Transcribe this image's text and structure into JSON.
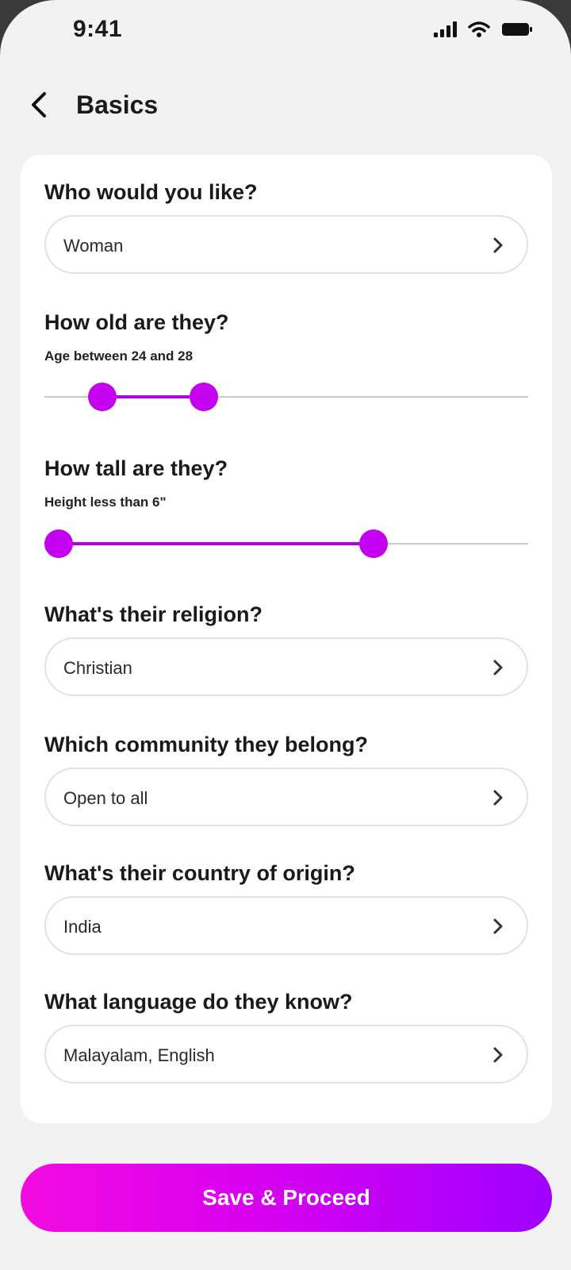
{
  "status_bar": {
    "time": "9:41",
    "icons": [
      "signal-icon",
      "wifi-icon",
      "battery-icon"
    ]
  },
  "header": {
    "title": "Basics",
    "back_icon": "chevron-left-icon"
  },
  "form": {
    "gender": {
      "question": "Who would you like?",
      "value": "Woman"
    },
    "age": {
      "question": "How old are they?",
      "caption": "Age between 24 and 28",
      "range_low": 0.12,
      "range_high": 0.33
    },
    "height": {
      "question": "How tall are they?",
      "caption": "Height less than 6\"",
      "range_low": 0.03,
      "range_high": 0.68
    },
    "religion": {
      "question": "What's their religion?",
      "value": "Christian"
    },
    "community": {
      "question": "Which community they belong?",
      "value": "Open to all"
    },
    "country": {
      "question": "What's their country of origin?",
      "value": "India"
    },
    "language": {
      "question": "What language do they know?",
      "value": "Malayalam, English"
    }
  },
  "actions": {
    "save_label": "Save & Proceed"
  },
  "colors": {
    "accent": "#c400f0",
    "gradient_start": "#f20be0",
    "gradient_end": "#a000ff",
    "background": "#f2f2f2",
    "card": "#ffffff"
  }
}
